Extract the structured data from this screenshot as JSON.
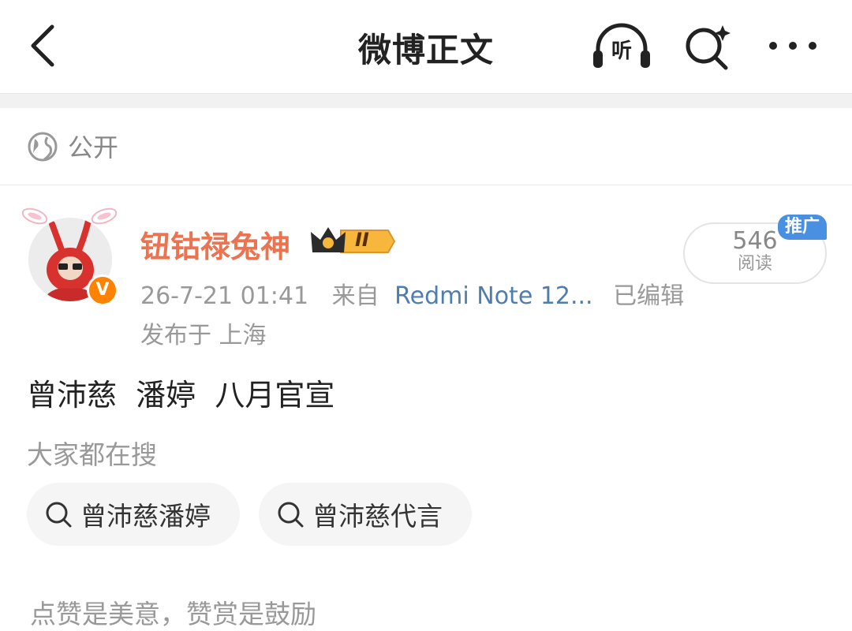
{
  "header": {
    "title": "微博正文",
    "listen_label": "听",
    "back_icon": "chevron-left-icon",
    "search_icon": "search-sparkle-icon",
    "more_icon": "more-horizontal-icon"
  },
  "visibility": {
    "icon": "globe-icon",
    "label": "公开"
  },
  "post": {
    "author": {
      "name": "钮钴禄兔神",
      "badge_level": "II",
      "verified_mark": "V",
      "name_color": "#eb7350"
    },
    "timestamp": "26-7-21 01:41",
    "source_prefix": "来自",
    "source": "Redmi Note 12...",
    "edited_label": "已编辑",
    "location": "发布于 上海",
    "reads": {
      "count": "546",
      "label": "阅读",
      "promo_tag": "推广"
    },
    "text": "曾沛慈  潘婷  八月官宣"
  },
  "related_searches": {
    "label": "大家都在搜",
    "items": [
      {
        "label": "曾沛慈潘婷",
        "icon": "search-icon"
      },
      {
        "label": "曾沛慈代言",
        "icon": "search-icon"
      }
    ]
  },
  "footer_note": "点赞是美意，赞赏是鼓励",
  "colors": {
    "accent_orange": "#ff8200",
    "link_blue": "#507daf",
    "promo_blue": "#4a90e2"
  }
}
